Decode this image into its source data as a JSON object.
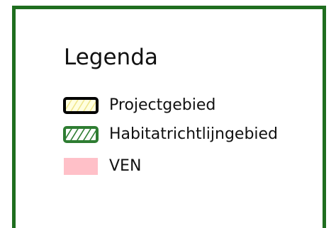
{
  "legend": {
    "title": "Legenda",
    "items": [
      {
        "label": "Projectgebied",
        "symbol": "projectgebied-swatch-icon",
        "fill": "#ffffe0",
        "hatch": "#f0e68c",
        "outline": "#000000"
      },
      {
        "label": "Habitatrichtlijngebied",
        "symbol": "habitatrichtlijngebied-swatch-icon",
        "fill": "#ffffff",
        "hatch": "#2e7d32",
        "outline": "#2e7d32"
      },
      {
        "label": "VEN",
        "symbol": "ven-swatch-icon",
        "fill": "#ffc0c8",
        "hatch": "",
        "outline": ""
      }
    ]
  },
  "colors": {
    "frame": "#1f6e1f"
  }
}
